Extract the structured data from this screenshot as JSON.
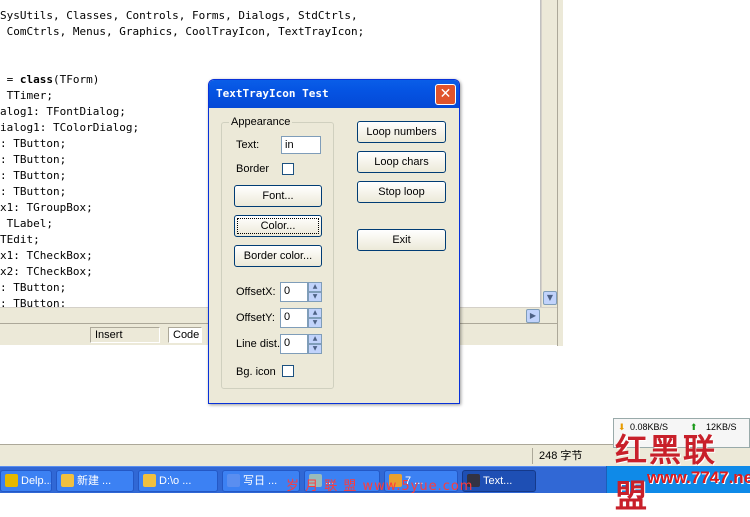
{
  "editor": {
    "code_lines": [
      {
        "pre": "SysUtils, Classes, Controls, Forms, Dialogs, StdCtrls,",
        "kw": "",
        "post": ""
      },
      {
        "pre": " ComCtrls, Menus, Graphics, CoolTrayIcon, TextTrayIcon;",
        "kw": "",
        "post": ""
      },
      {
        "pre": "",
        "kw": "",
        "post": ""
      },
      {
        "pre": "",
        "kw": "",
        "post": ""
      },
      {
        "pre": " = ",
        "kw": "class",
        "post": "(TForm)"
      },
      {
        "pre": " TTimer;",
        "kw": "",
        "post": ""
      },
      {
        "pre": "alog1: TFontDialog;",
        "kw": "",
        "post": ""
      },
      {
        "pre": "ialog1: TColorDialog;",
        "kw": "",
        "post": ""
      },
      {
        "pre": ": TButton;",
        "kw": "",
        "post": ""
      },
      {
        "pre": ": TButton;",
        "kw": "",
        "post": ""
      },
      {
        "pre": ": TButton;",
        "kw": "",
        "post": ""
      },
      {
        "pre": ": TButton;",
        "kw": "",
        "post": ""
      },
      {
        "pre": "x1: TGroupBox;",
        "kw": "",
        "post": ""
      },
      {
        "pre": " TLabel;",
        "kw": "",
        "post": ""
      },
      {
        "pre": "TEdit;",
        "kw": "",
        "post": ""
      },
      {
        "pre": "x1: TCheckBox;",
        "kw": "",
        "post": ""
      },
      {
        "pre": "x2: TCheckBox;",
        "kw": "",
        "post": ""
      },
      {
        "pre": ": TButton;",
        "kw": "",
        "post": ""
      },
      {
        "pre": ": TButton;",
        "kw": "",
        "post": ""
      }
    ],
    "status_insert": "Insert",
    "tab_code": "Code",
    "scroll_down_icon": "chevron-down-icon",
    "scroll_right_icon": "chevron-right-icon",
    "scroll_left_icon": "chevron-left-icon"
  },
  "dialog": {
    "title": "TextTrayIcon Test",
    "close_icon": "close-icon",
    "group_title": "Appearance",
    "text_label": "Text:",
    "text_value": "in",
    "border_label": "Border",
    "font_button": "Font...",
    "color_button": "Color...",
    "border_color_button": "Border color...",
    "offset_x_label": "OffsetX:",
    "offset_x_value": "0",
    "offset_y_label": "OffsetY:",
    "offset_y_value": "0",
    "line_dist_label": "Line dist.:",
    "line_dist_value": "0",
    "bg_icon_label": "Bg. icon",
    "loop_numbers_button": "Loop numbers",
    "loop_chars_button": "Loop chars",
    "stop_loop_button": "Stop loop",
    "exit_button": "Exit",
    "colors": {
      "title_bar": "#0553e2",
      "close": "#e0542c",
      "face": "#ece9d8"
    }
  },
  "status_bar": {
    "bytes": "248 字节"
  },
  "net_monitor": {
    "down": "0.08KB/S",
    "up": "12KB/S"
  },
  "taskbar": {
    "items": [
      {
        "label": "Delp...",
        "active": false
      },
      {
        "label": "新建 ...",
        "active": false
      },
      {
        "label": "D:\\o ...",
        "active": false
      },
      {
        "label": "写日 ...",
        "active": false
      },
      {
        "label": "...",
        "active": false
      },
      {
        "label": "7 ...",
        "active": false
      },
      {
        "label": "Text...",
        "active": true
      }
    ]
  },
  "watermarks": {
    "logo": "红黑联盟",
    "site": "www.7747.net",
    "banner": "岁 月 联 盟  www.5yue.com"
  }
}
